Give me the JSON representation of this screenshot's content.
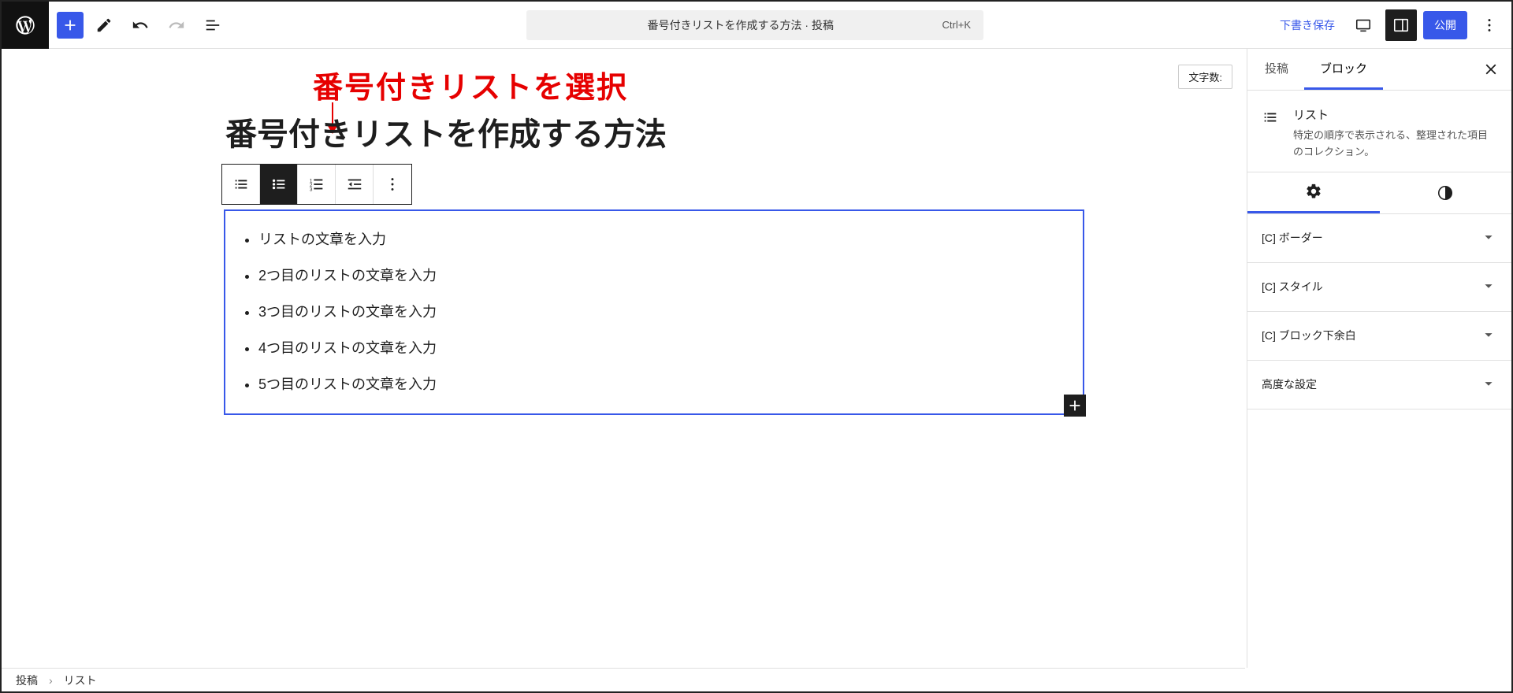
{
  "topbar": {
    "cmd_title": "番号付きリストを作成する方法 · 投稿",
    "cmd_shortcut": "Ctrl+K",
    "save_draft": "下書き保存",
    "publish": "公開"
  },
  "annotation": {
    "text": "番号付きリストを選択"
  },
  "word_count_label": "文字数:",
  "post_title": "番号付きリストを作成する方法",
  "list_items": [
    "リストの文章を入力",
    "2つ目のリストの文章を入力",
    "3つ目のリストの文章を入力",
    "4つ目のリストの文章を入力",
    "5つ目のリストの文章を入力"
  ],
  "sidebar": {
    "tabs": {
      "post": "投稿",
      "block": "ブロック"
    },
    "block": {
      "name": "リスト",
      "description": "特定の順序で表示される、整理された項目のコレクション。"
    },
    "panels": {
      "border": "[C] ボーダー",
      "style": "[C] スタイル",
      "margin": "[C] ブロック下余白",
      "advanced": "高度な設定"
    }
  },
  "footer": {
    "crumb1": "投稿",
    "crumb2": "リスト"
  }
}
